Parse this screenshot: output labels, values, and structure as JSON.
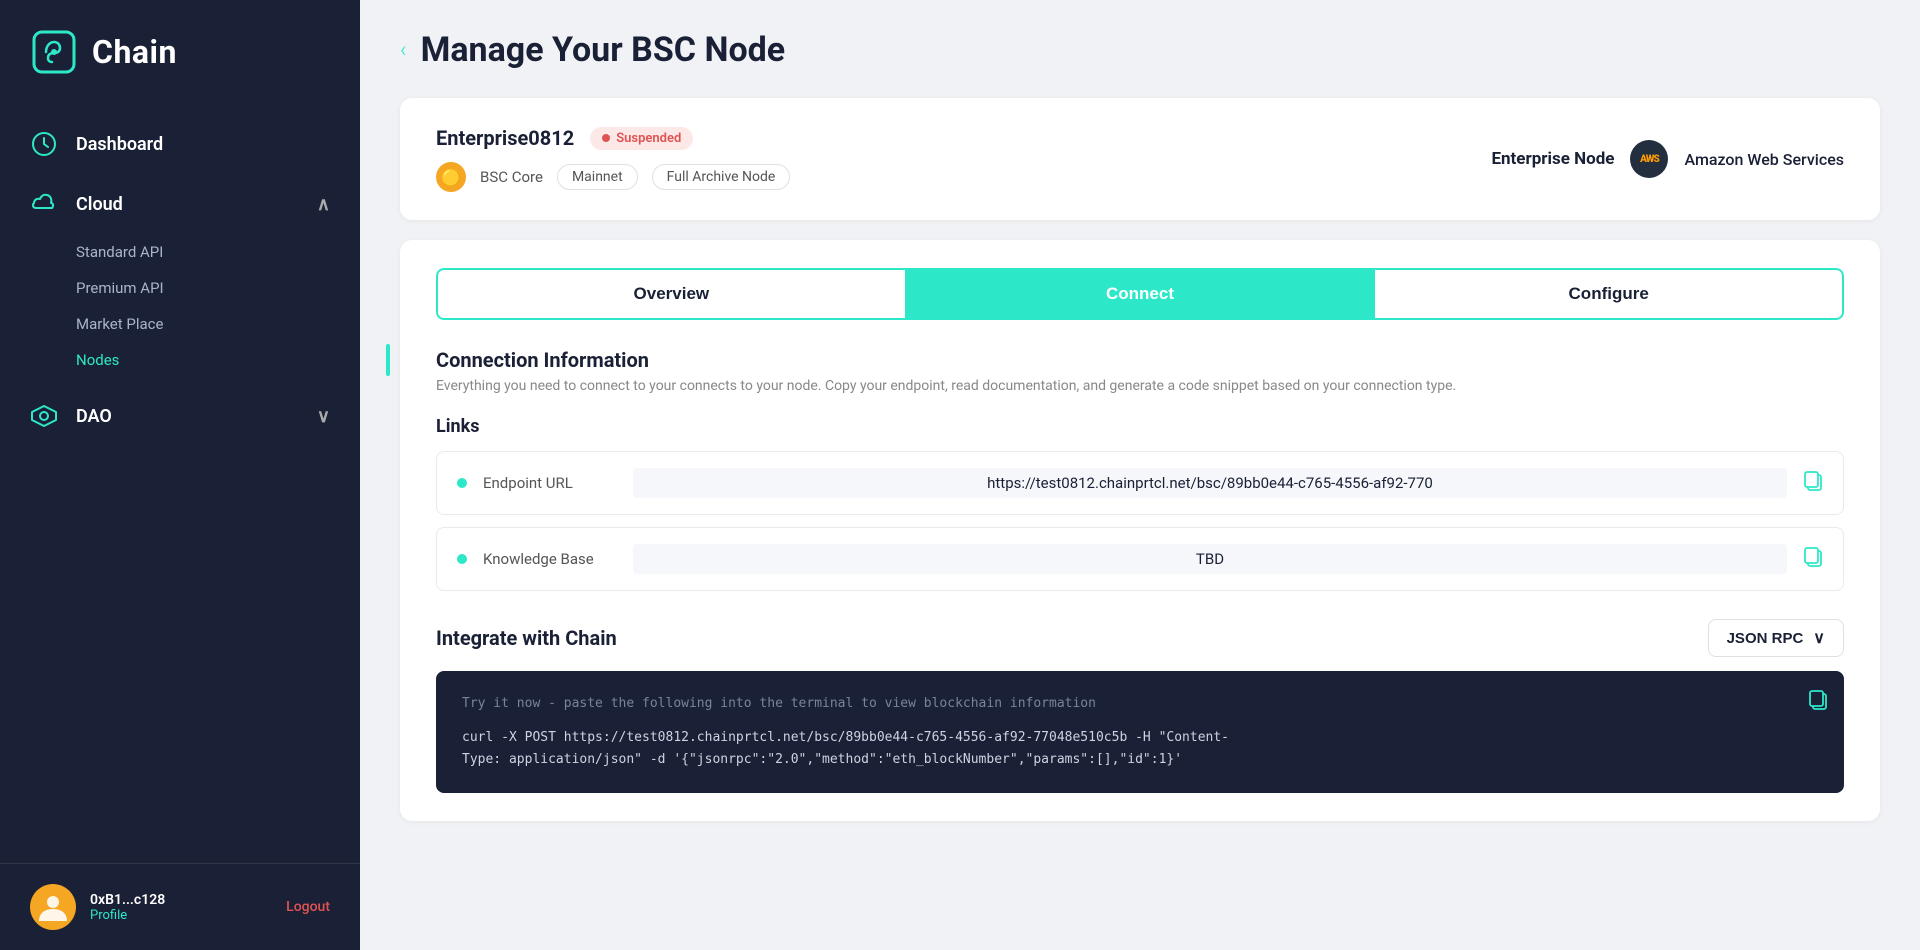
{
  "sidebar": {
    "logo_text": "Chain",
    "nav_items": [
      {
        "id": "dashboard",
        "label": "Dashboard",
        "icon": "dashboard-icon",
        "active": false
      },
      {
        "id": "cloud",
        "label": "Cloud",
        "icon": "cloud-icon",
        "expanded": true,
        "sub": [
          {
            "id": "standard-api",
            "label": "Standard API",
            "active": false
          },
          {
            "id": "premium-api",
            "label": "Premium API",
            "active": false
          },
          {
            "id": "marketplace",
            "label": "Market Place",
            "active": false
          },
          {
            "id": "nodes",
            "label": "Nodes",
            "active": true
          }
        ]
      },
      {
        "id": "dao",
        "label": "DAO",
        "icon": "dao-icon",
        "expanded": false
      }
    ],
    "footer": {
      "username": "0xB1...c128",
      "profile_label": "Profile",
      "logout_label": "Logout"
    }
  },
  "page": {
    "back_label": "‹",
    "title": "Manage Your BSC Node"
  },
  "node_card": {
    "name": "Enterprise0812",
    "status": "Suspended",
    "chain": "BSC Core",
    "network": "Mainnet",
    "node_type": "Full Archive Node",
    "tier_label": "Enterprise Node",
    "provider_label": "Amazon Web Services",
    "provider_short": "AWS"
  },
  "tabs": [
    {
      "id": "overview",
      "label": "Overview",
      "active": false
    },
    {
      "id": "connect",
      "label": "Connect",
      "active": true
    },
    {
      "id": "configure",
      "label": "Configure",
      "active": false
    }
  ],
  "connection_info": {
    "title": "Connection Information",
    "description": "Everything you need to connect to your connects to your node. Copy your endpoint, read documentation, and generate a code snippet based on your connection type."
  },
  "links": {
    "title": "Links",
    "rows": [
      {
        "label": "Endpoint URL",
        "value": "https://test0812.chainprtcl.net/bsc/89bb0e44-c765-4556-af92-770"
      },
      {
        "label": "Knowledge Base",
        "value": "TBD"
      }
    ]
  },
  "integrate": {
    "title": "Integrate with Chain",
    "dropdown_label": "JSON RPC",
    "code_comment": "Try it now - paste the following into the terminal to view blockchain information",
    "code_line1": "curl -X POST https://test0812.chainprtcl.net/bsc/89bb0e44-c765-4556-af92-77048e510c5b -H \"Content-",
    "code_line2": "Type: application/json\" -d '{\"jsonrpc\":\"2.0\",\"method\":\"eth_blockNumber\",\"params\":[],\"id\":1}'"
  }
}
